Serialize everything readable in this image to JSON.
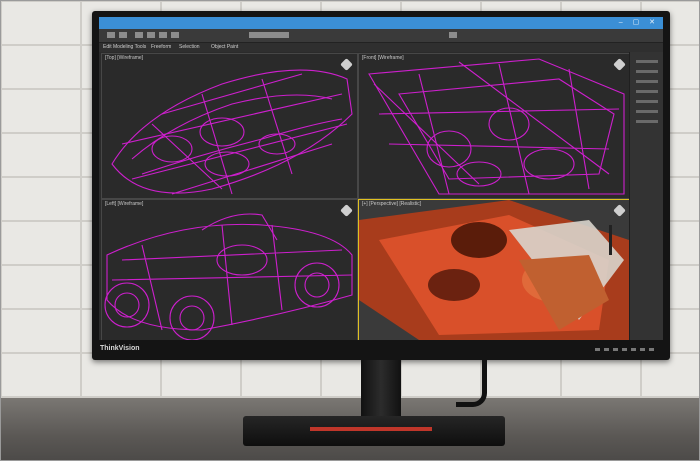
{
  "scene": {
    "brand_label": "ThinkVision",
    "colors": {
      "wireframe": "#d61fd6",
      "render": "#d9502a",
      "accent": "#3b8fd6",
      "active_viewport": "#e0c020"
    }
  },
  "app": {
    "title": "",
    "ribbon": [
      "Edit Modeling Tools",
      "Freeform",
      "Selection",
      "Object Paint"
    ],
    "viewports": [
      {
        "label": "[Top] [Wireframe]"
      },
      {
        "label": "[Front] [Wireframe]"
      },
      {
        "label": "[Left] [Wireframe]"
      },
      {
        "label": "[+] [Perspective] [Realistic]"
      }
    ]
  }
}
